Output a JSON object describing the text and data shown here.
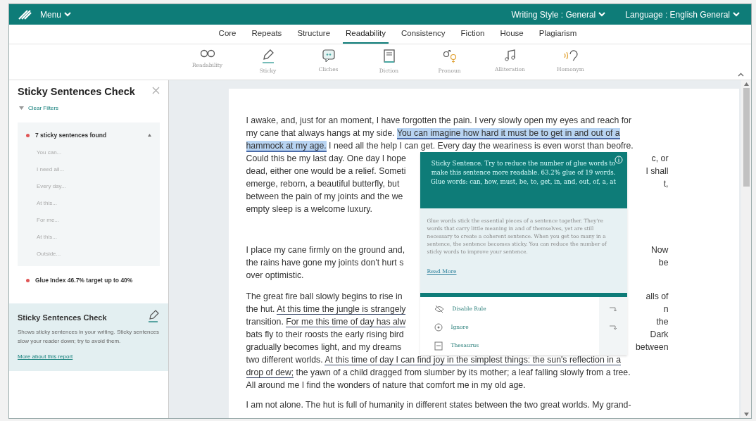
{
  "topbar": {
    "menu": "Menu",
    "writing_style": "Writing Style : General",
    "language": "Language : English General"
  },
  "tabs": [
    {
      "label": "Core",
      "selected": false
    },
    {
      "label": "Repeats",
      "selected": false
    },
    {
      "label": "Structure",
      "selected": false
    },
    {
      "label": "Readability",
      "selected": true
    },
    {
      "label": "Consistency",
      "selected": false
    },
    {
      "label": "Fiction",
      "selected": false
    },
    {
      "label": "House",
      "selected": false
    },
    {
      "label": "Plagiarism",
      "selected": false
    }
  ],
  "tools": [
    {
      "kind": "glasses",
      "label": "Readability"
    },
    {
      "kind": "sticky",
      "label": "Sticky"
    },
    {
      "kind": "cliches",
      "label": "Cliches"
    },
    {
      "kind": "diction",
      "label": "Diction"
    },
    {
      "kind": "pronoun",
      "label": "Pronoun"
    },
    {
      "kind": "alliteration",
      "label": "Alliteration"
    },
    {
      "kind": "homonym",
      "label": "Homonym"
    }
  ],
  "sidebar": {
    "title": "Sticky Sentences Check",
    "clear_filters": "Clear Filters",
    "groups": [
      {
        "label": "7 sticky sentences found",
        "color": "#e05555",
        "expanded": true,
        "items": [
          "You can...",
          "I need all...",
          "Every day...",
          "At this...",
          "For me...",
          "At this...",
          "Outside..."
        ]
      },
      {
        "label": "Glue Index 46.7% target up to 40%",
        "color": "#e05555",
        "expanded": false
      }
    ],
    "info": {
      "title": "Sticky Sentences Check",
      "text": "Shows sticky sentences in your writing. Sticky sentences slow your reader down; try to avoid them.",
      "link": "More about this report"
    }
  },
  "document": {
    "paragraphs": [
      [
        {
          "left": [
            {
              "text": "I awake, and, just for an moment, I have forgotten the pain. I very slowly open my eyes and reach for",
              "kind": "plain"
            }
          ]
        },
        {
          "left": [
            {
              "text": "my cane that always hangs at my side. ",
              "kind": "plain"
            },
            {
              "text": "You can imagine how hard it must be to get in and out of a",
              "kind": "highlight"
            }
          ]
        },
        {
          "left": [
            {
              "text": "hammock at my age.",
              "kind": "highlight"
            },
            {
              "text": " I need all the help I can get. Every day the weariness is even worst than beofre.",
              "kind": "plain"
            }
          ]
        },
        {
          "left": [
            {
              "text": "Could this be my last day. One day I hope",
              "kind": "plain"
            }
          ],
          "right": [
            {
              "text": "c, or",
              "kind": "plain"
            }
          ]
        },
        {
          "left": [
            {
              "text": "dead, either one would be a relief. Someti",
              "kind": "plain"
            }
          ],
          "right": [
            {
              "text": "I shall",
              "kind": "plain"
            }
          ]
        },
        {
          "left": [
            {
              "text": "emerge, reborn, a beautiful butterfly, but",
              "kind": "plain"
            }
          ],
          "right": [
            {
              "text": "t,",
              "kind": "plain"
            }
          ]
        },
        {
          "left": [
            {
              "text": "between the pain of my joints and the we",
              "kind": "plain"
            }
          ]
        },
        {
          "left": [
            {
              "text": "empty sleep is a welcome luxury.",
              "kind": "plain"
            }
          ]
        }
      ],
      [
        {
          "left": [
            {
              "text": "I place my cane firmly on the ground and,",
              "kind": "plain"
            }
          ],
          "right": [
            {
              "text": "Now",
              "kind": "plain"
            }
          ]
        },
        {
          "left": [
            {
              "text": "the rains have gone my joints don't hurt s",
              "kind": "plain"
            }
          ],
          "right": [
            {
              "text": "be",
              "kind": "plain"
            }
          ]
        },
        {
          "left": [
            {
              "text": "over optimistic.",
              "kind": "plain"
            }
          ]
        }
      ],
      [
        {
          "left": [
            {
              "text": "The great fire ball slowly begins to rise in",
              "kind": "plain"
            }
          ],
          "right": [
            {
              "text": "alls of",
              "kind": "plain"
            }
          ]
        },
        {
          "left": [
            {
              "text": "the hut. ",
              "kind": "plain"
            },
            {
              "text": "At this time the jungle is strangely",
              "kind": "underline"
            }
          ],
          "right": [
            {
              "text": "n",
              "kind": "plain"
            }
          ]
        },
        {
          "left": [
            {
              "text": "transition. ",
              "kind": "plain"
            },
            {
              "text": "For me this time of day has alw",
              "kind": "underline"
            }
          ],
          "right": [
            {
              "text": "the",
              "kind": "plain"
            }
          ]
        },
        {
          "left": [
            {
              "text": "bats fly to their roosts the early rising bird",
              "kind": "plain"
            }
          ],
          "right": [
            {
              "text": "Dark",
              "kind": "plain"
            }
          ]
        },
        {
          "left": [
            {
              "text": "gradually becomes light, and my dreams",
              "kind": "plain"
            }
          ],
          "right": [
            {
              "text": "between",
              "kind": "plain"
            }
          ]
        },
        {
          "left": [
            {
              "text": "two different worlds. ",
              "kind": "plain"
            },
            {
              "text": "At this time of day I can find joy in the simplest things: the sun's reflection in a",
              "kind": "underline"
            }
          ]
        },
        {
          "left": [
            {
              "text": "drop of dew;",
              "kind": "underline"
            },
            {
              "text": " the yawn of a child dragged from slumber by its mother; a leaf falling slowly from a tree.",
              "kind": "plain"
            }
          ]
        },
        {
          "left": [
            {
              "text": "All around me I find the wonders of nature that comfort me in my old age.",
              "kind": "plain"
            }
          ]
        }
      ],
      [
        {
          "left": [
            {
              "text": "I am not alone. The hut is full of humanity in different states between the two great worlds. My grand-",
              "kind": "plain"
            }
          ]
        }
      ]
    ]
  },
  "popup": {
    "message": "Sticky Sentence. Try to reduce the number of glue words to make this sentence more readable. 63.2% glue of 19 words. Glue words: can, how, must, be, to, get, in, and, out, of, a, at",
    "body": "Glue words stick the essential pieces of a sentence together. They're words that carry little meaning in and of themselves, yet are still necessary to create a coherent sentence. When you get too many in a sentence, the sentence becomes sticky. You can reduce the number of sticky words to improve your sentence.",
    "link": "Read More",
    "actions": [
      {
        "kind": "disable",
        "label": "Disable Rule",
        "arrow": true
      },
      {
        "kind": "ignore",
        "label": "Ignore",
        "arrow": true
      },
      {
        "kind": "thesaurus",
        "label": "Thesaurus",
        "arrow": false
      }
    ]
  }
}
